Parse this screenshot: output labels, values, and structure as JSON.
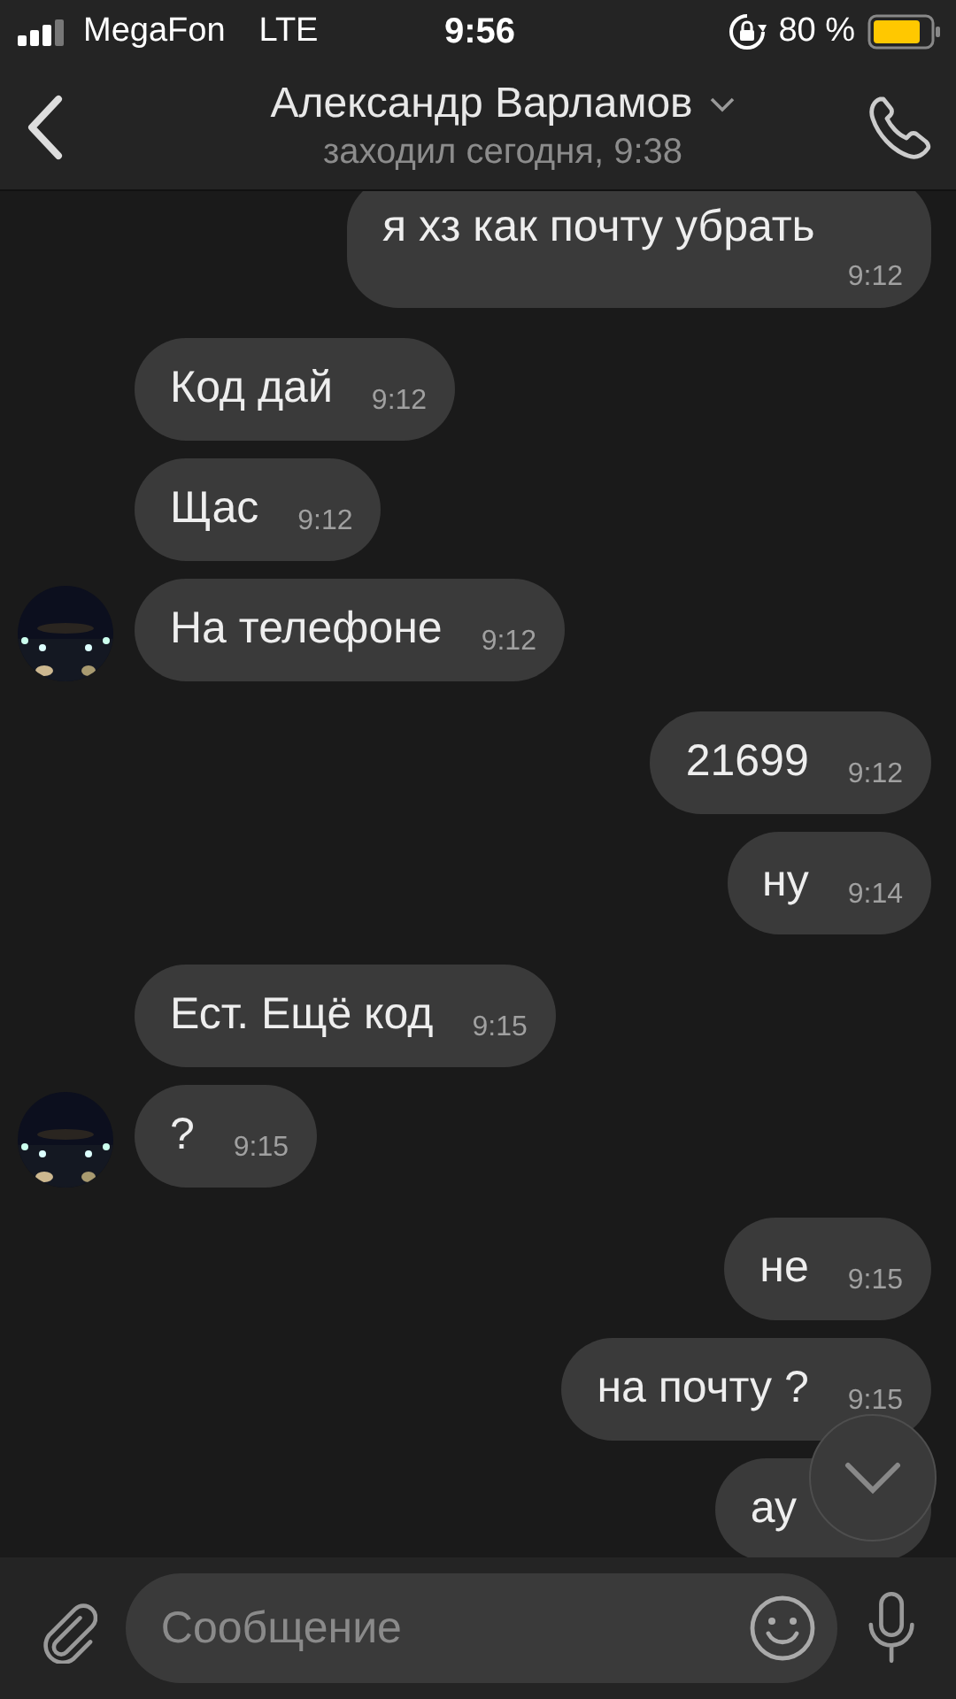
{
  "status_bar": {
    "carrier": "MegaFon",
    "network": "LTE",
    "time": "9:56",
    "battery": "80 %"
  },
  "header": {
    "title": "Александр Варламов",
    "subtitle": "заходил сегодня, 9:38"
  },
  "messages": [
    {
      "outgoing": true,
      "text": "я хз как почту убрать",
      "time": "9:12"
    },
    {
      "outgoing": false,
      "text": "Код дай",
      "time": "9:12",
      "avatar": false
    },
    {
      "outgoing": false,
      "text": "Щас",
      "time": "9:12",
      "avatar": false
    },
    {
      "outgoing": false,
      "text": "На телефоне",
      "time": "9:12",
      "avatar": true
    },
    {
      "outgoing": true,
      "text": "21699",
      "time": "9:12"
    },
    {
      "outgoing": true,
      "text": "ну",
      "time": "9:14"
    },
    {
      "outgoing": false,
      "text": "Ест. Ещё код",
      "time": "9:15",
      "avatar": false
    },
    {
      "outgoing": false,
      "text": "?",
      "time": "9:15",
      "avatar": true
    },
    {
      "outgoing": true,
      "text": "не",
      "time": "9:15"
    },
    {
      "outgoing": true,
      "text": "на почту ?",
      "time": "9:15"
    },
    {
      "outgoing": true,
      "text": "ау"
    }
  ],
  "composer": {
    "placeholder": "Сообщение"
  }
}
